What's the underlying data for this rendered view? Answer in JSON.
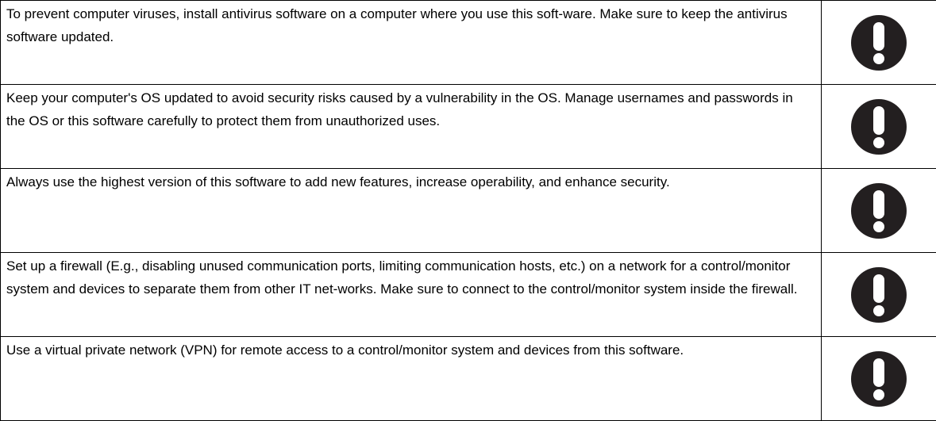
{
  "notices": [
    {
      "text": "To prevent computer viruses, install antivirus software on a computer where you use this soft-ware. Make sure to keep the antivirus software updated.",
      "icon": "mandatory-action-icon"
    },
    {
      "text": "Keep your computer's OS updated to avoid security risks caused by a vulnerability in the OS. Manage usernames and passwords in the OS or this software carefully to protect them from unauthorized uses.",
      "icon": "mandatory-action-icon"
    },
    {
      "text": "Always use the highest version of this software to add new features, increase operability, and enhance security.",
      "icon": "mandatory-action-icon"
    },
    {
      "text": "Set up a firewall (E.g., disabling unused communication ports, limiting communication hosts, etc.) on a network for a control/monitor system and devices to separate them from other IT net-works. Make sure to connect to the control/monitor system inside the firewall.",
      "icon": "mandatory-action-icon"
    },
    {
      "text": "Use a virtual private network (VPN) for remote access to a control/monitor system and devices from this software.",
      "icon": "mandatory-action-icon"
    }
  ],
  "colors": {
    "border": "#000000",
    "icon_fill": "#231f20",
    "icon_mark": "#ffffff"
  }
}
